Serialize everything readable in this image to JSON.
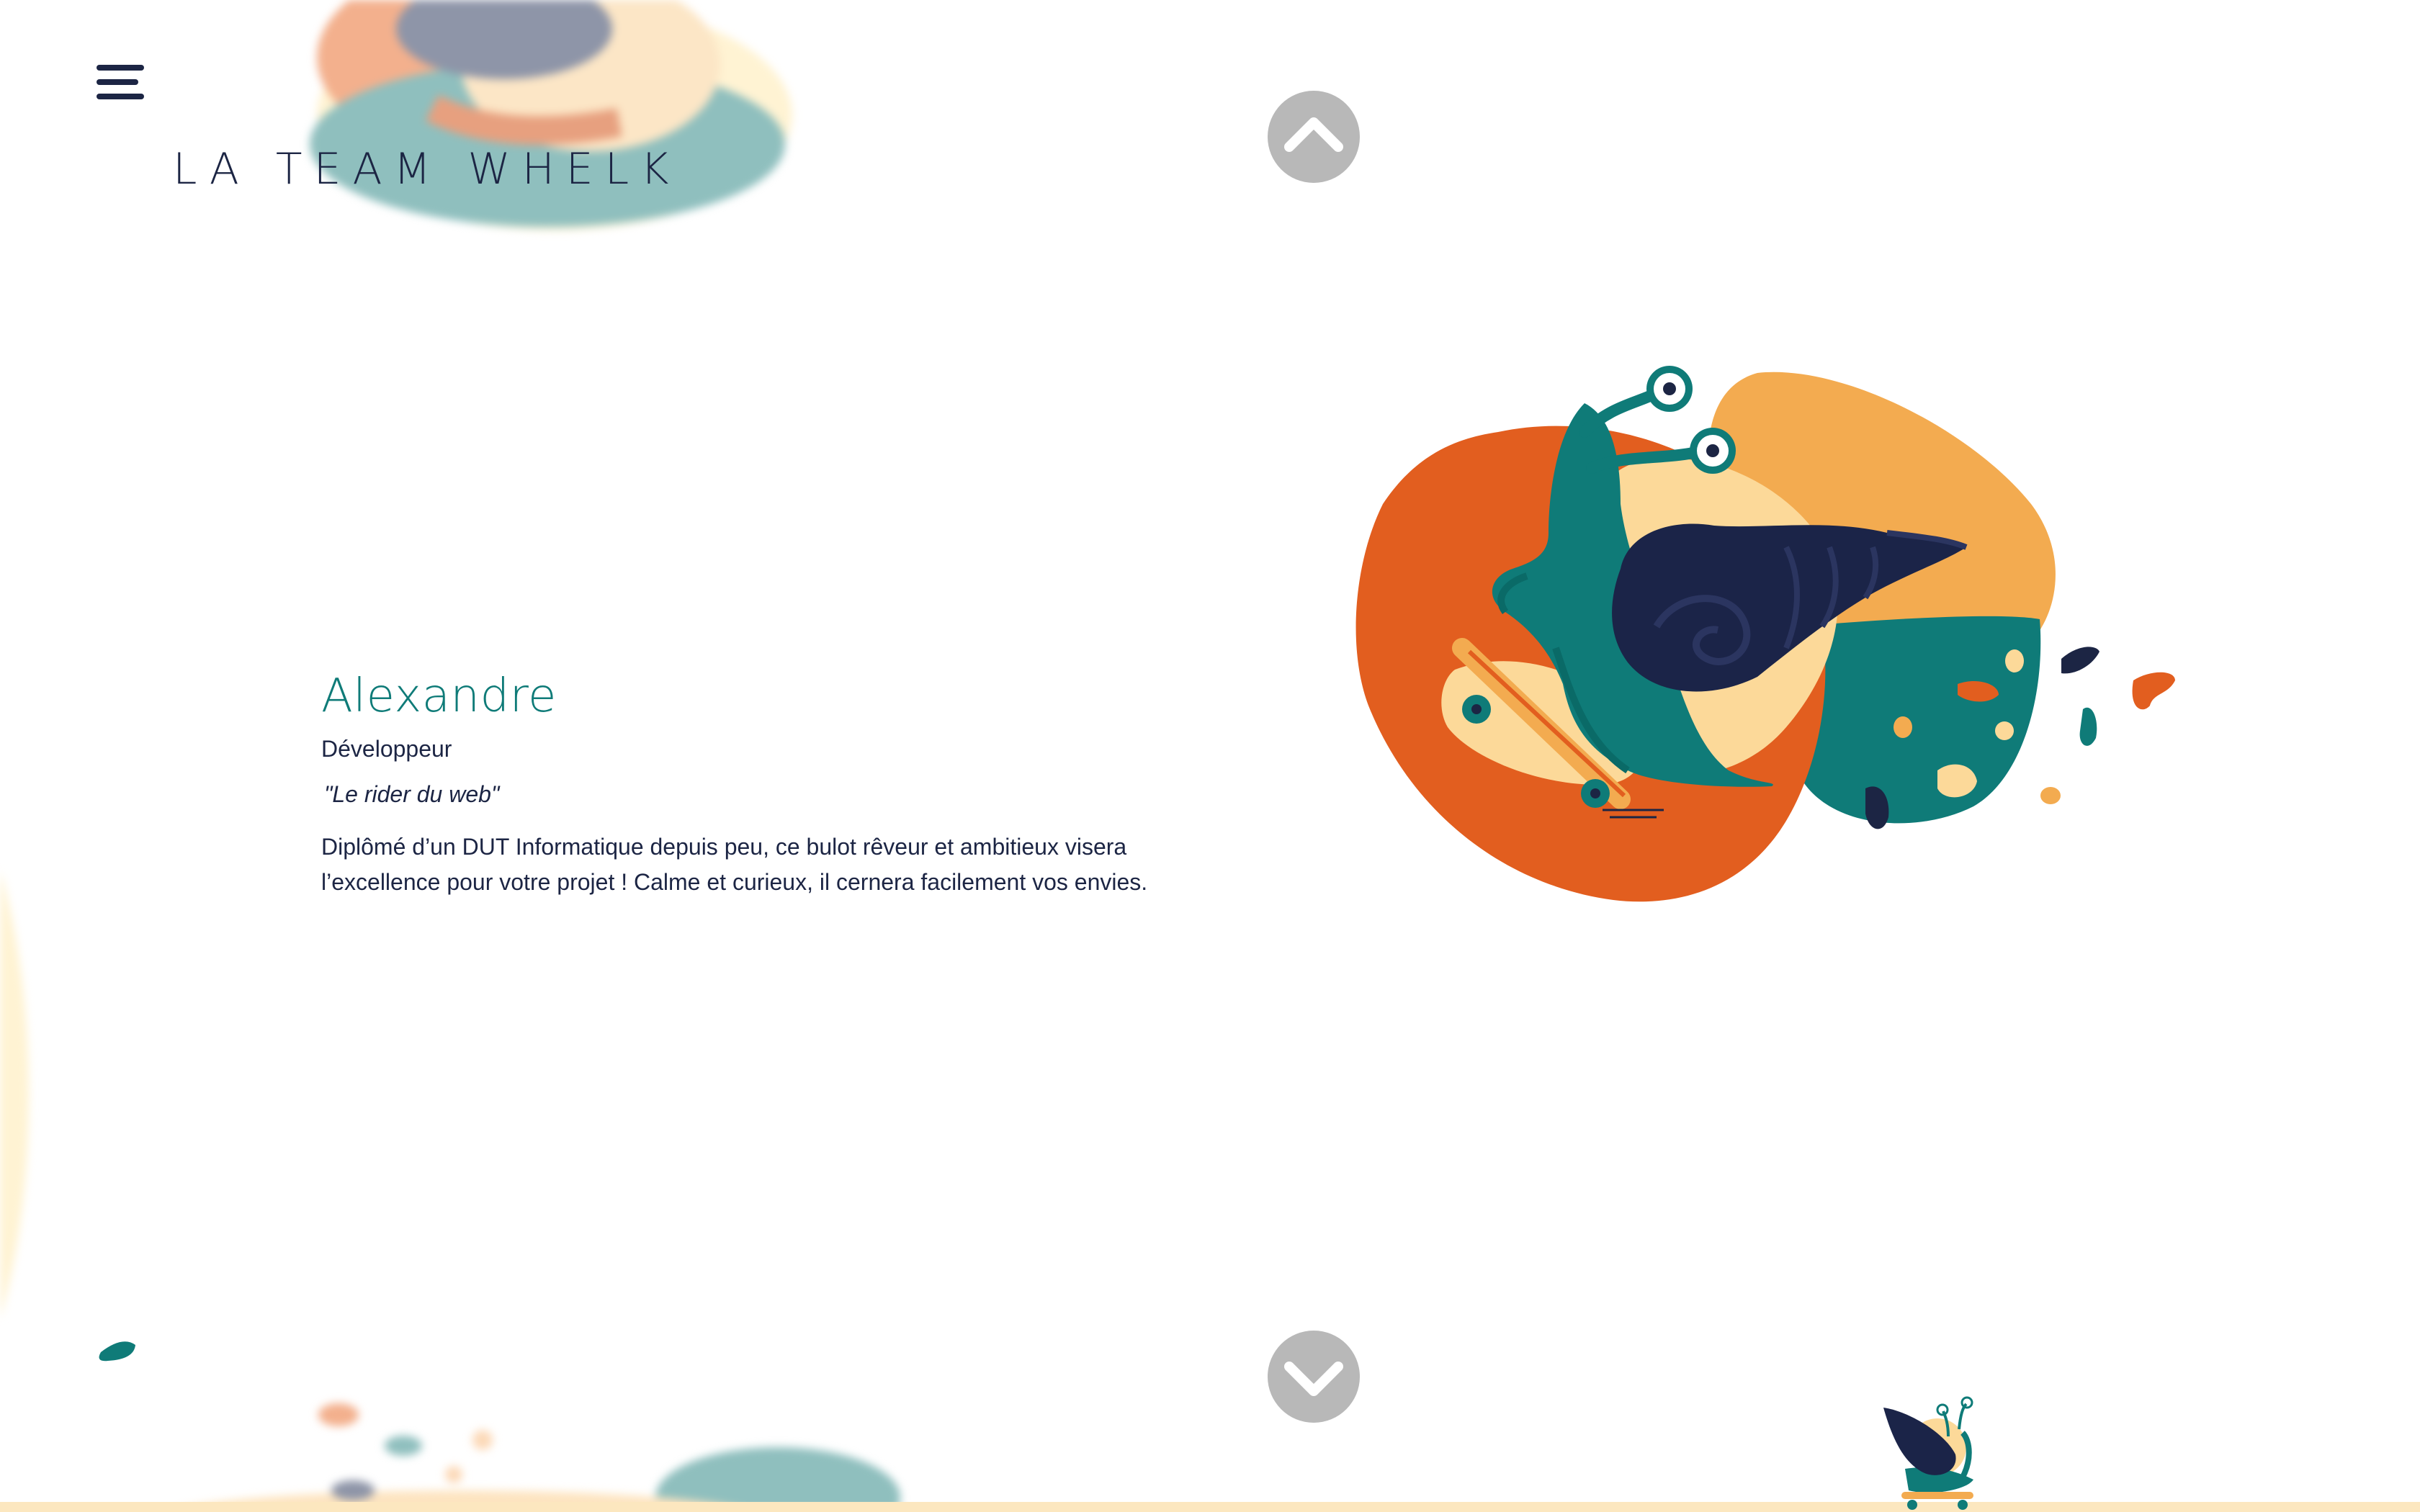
{
  "brand": {
    "logo_text": "LA TEAM WHELK"
  },
  "navigation": {
    "menu_icon": "hamburger-menu-icon",
    "previous_icon": "chevron-up-icon",
    "next_icon": "chevron-down-icon"
  },
  "member": {
    "name": "Alexandre",
    "role": "Développeur",
    "quote": "\"Le rider du web\"",
    "bio_line_1": "Diplômé d’un DUT Informatique depuis peu, ce bulot rêveur et ambitieux visera",
    "bio_line_2": "l’excellence pour votre projet ! Calme et curieux, il cernera facilement vos envies."
  },
  "colors": {
    "navy": "#1c2544",
    "teal": "#0f7b78",
    "orange": "#e25e1f",
    "light_orange": "#f3ab50",
    "cream": "#fcd999",
    "pale_cream": "#fff3d3",
    "nav_grey": "#b8b8b8"
  }
}
